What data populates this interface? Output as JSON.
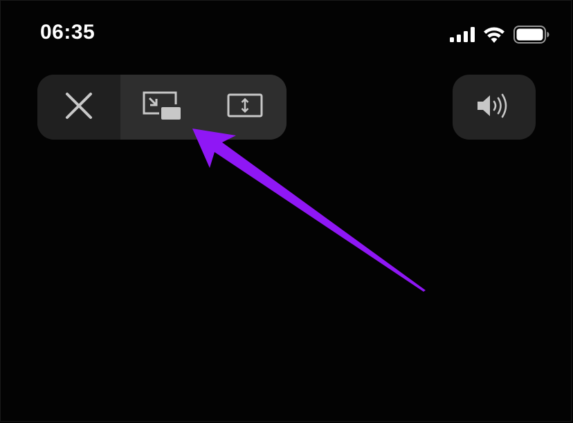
{
  "status_bar": {
    "time": "06:35",
    "icons": [
      "cellular-signal-icon",
      "wifi-icon",
      "battery-icon"
    ]
  },
  "controls": {
    "close_icon": "close-icon",
    "pip_icon": "picture-in-picture-icon",
    "zoom_icon": "aspect-fill-icon",
    "volume_icon": "speaker-volume-icon"
  },
  "annotation": {
    "color": "#8f17f5",
    "target": "pip-button"
  },
  "colors": {
    "background": "#030303",
    "pill": "#242424",
    "pill_active": "#2e2e2e",
    "icon": "#c8c8c8"
  }
}
